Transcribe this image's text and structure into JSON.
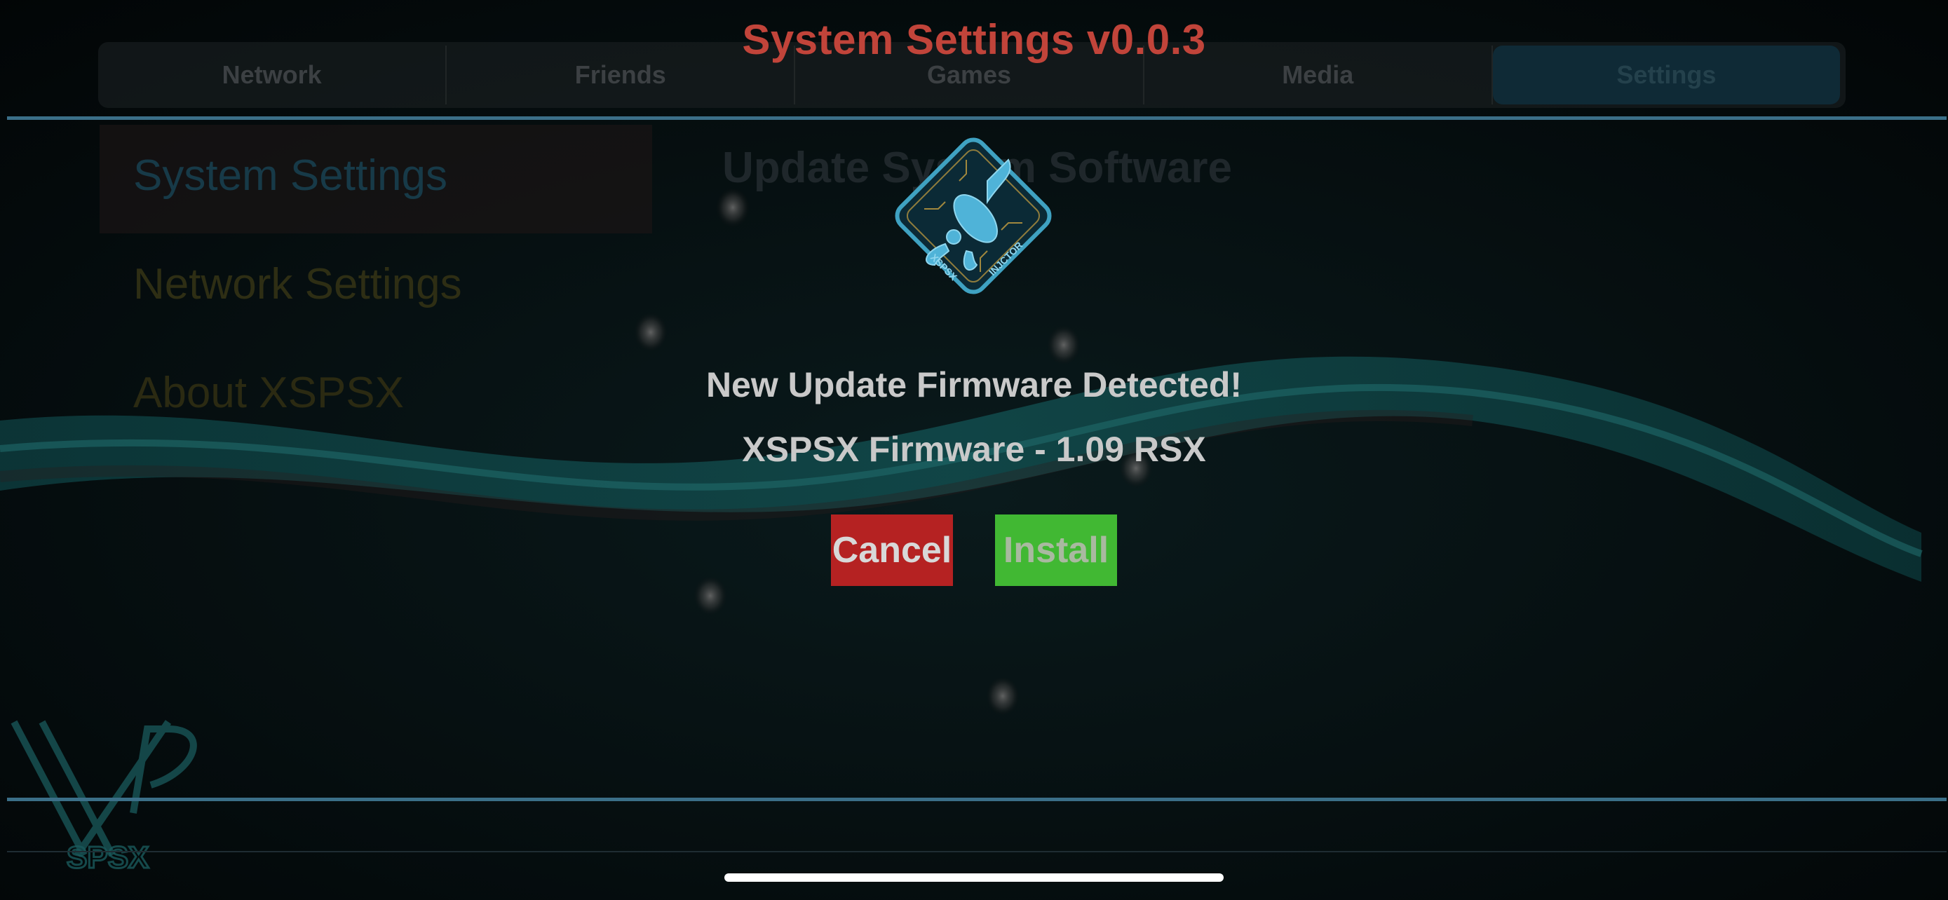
{
  "header": {
    "title": "System Settings v0.0.3",
    "tabs": [
      {
        "label": "Network",
        "active": false
      },
      {
        "label": "Friends",
        "active": false
      },
      {
        "label": "Games",
        "active": false
      },
      {
        "label": "Media",
        "active": false
      },
      {
        "label": "Settings",
        "active": true
      }
    ]
  },
  "sidebar": {
    "items": [
      {
        "label": "System Settings",
        "selected": true
      },
      {
        "label": "Network Settings",
        "selected": false
      },
      {
        "label": "About XSPSX",
        "selected": false
      }
    ]
  },
  "content": {
    "title": "Update System Software"
  },
  "modal": {
    "logo_text_left": "XSPSX",
    "logo_text_right": "INJCTOR",
    "message": "New Update Firmware Detected!",
    "firmware": "XSPSX Firmware - 1.09 RSX",
    "cancel_label": "Cancel",
    "install_label": "Install"
  },
  "colors": {
    "title": "#c1443a",
    "accent_line": "#3b6f88",
    "cancel": "#b52222",
    "install": "#41b833"
  },
  "icons": {
    "modal_logo": "scorpion-circuit-logo",
    "corner_logo": "xsp-logo"
  }
}
